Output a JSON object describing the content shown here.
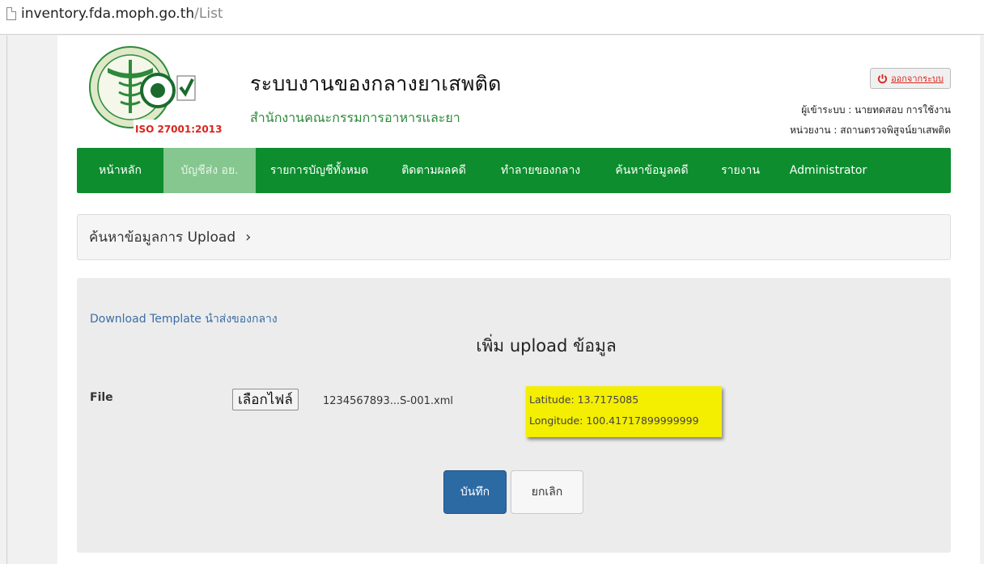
{
  "browser": {
    "url_host": "inventory.fda.moph.go.th",
    "url_path": "/List"
  },
  "header": {
    "logo_caption": "ISO 27001:2013",
    "title": "ระบบงานของกลางยาเสพติด",
    "subtitle": "สำนักงานคณะกรรมการอาหารและยา",
    "logout_label": "ออกจากระบบ",
    "user_line": "ผู้เข้าระบบ : นายทดสอบ การใช้งาน",
    "unit_line": "หน่วยงาน : สถานตรวจพิสูจน์ยาเสพติด"
  },
  "nav": {
    "items": [
      {
        "label": "หน้าหลัก"
      },
      {
        "label": "บัญชีส่ง อย."
      },
      {
        "label": "รายการบัญชีทั้งหมด"
      },
      {
        "label": "ติดตามผลคดี"
      },
      {
        "label": "ทำลายของกลาง"
      },
      {
        "label": "ค้นหาข้อมูลคดี"
      },
      {
        "label": "รายงาน"
      },
      {
        "label": "Administrator"
      }
    ]
  },
  "search": {
    "label": "ค้นหาข้อมูลการ Upload",
    "chevron": "›"
  },
  "upload": {
    "download_link": "Download Template นำส่งของกลาง",
    "title": "เพิ่ม upload ข้อมูล",
    "file_label": "File",
    "choose_file_label": "เลือกไฟล์",
    "file_name": "1234567893...S-001.xml",
    "latitude": "Latitude: 13.7175085",
    "longitude": "Longitude: 100.41717899999999",
    "save_label": "บันทึก",
    "cancel_label": "ยกเลิก"
  },
  "colors": {
    "nav_bg": "#0d8d2e",
    "nav_active": "#85c78f",
    "primary_button": "#2c6aa4",
    "highlight": "#f4ee00",
    "logout_red": "#d9251c"
  }
}
